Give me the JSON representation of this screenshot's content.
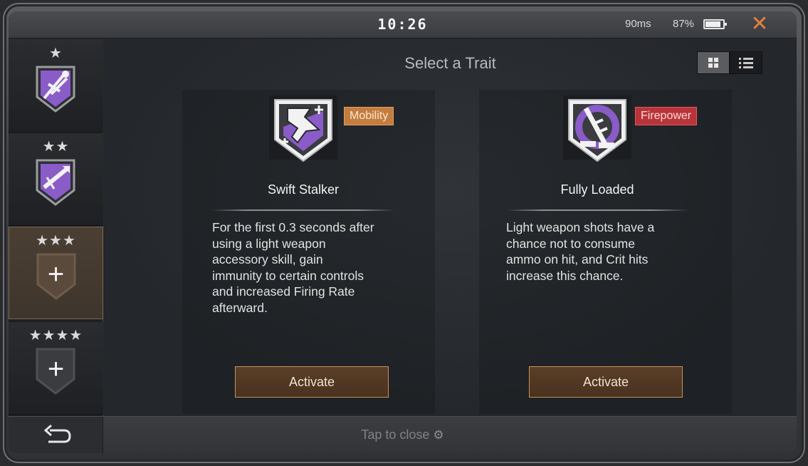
{
  "status_bar": {
    "time": "10:26",
    "ping": "90ms",
    "battery": "87%",
    "battery_level": 0.87,
    "close_icon": "close-x-icon"
  },
  "header": {
    "title": "Select a Trait",
    "view_toggle": [
      {
        "icon": "grid-view-icon",
        "selected": true
      },
      {
        "icon": "list-view-icon",
        "selected": false
      }
    ]
  },
  "sidebar": {
    "tiers": [
      {
        "stars": "★",
        "state": "filled",
        "icon": "trait-emblem-icon"
      },
      {
        "stars": "★★",
        "state": "filled",
        "icon": "trait-emblem-icon"
      },
      {
        "stars": "★★★",
        "state": "empty",
        "plus": "+",
        "active": true
      },
      {
        "stars": "★★★★",
        "state": "empty",
        "plus": "+"
      }
    ]
  },
  "traits": [
    {
      "name": "Swift Stalker",
      "tag": "Mobility",
      "tag_color": "#c47d3f",
      "icon": "swift-stalker-emblem-icon",
      "description": "For the first 0.3 seconds after\n using a light weapon\naccessory skill, gain\nimmunity to certain controls\nand increased Firing Rate\nafterward.",
      "button": "Activate"
    },
    {
      "name": "Fully Loaded",
      "tag": "Firepower",
      "tag_color": "#b8343a",
      "icon": "fully-loaded-emblem-icon",
      "description": "Light weapon shots have a\nchance not to consume\nammo on hit, and Crit hits\nincrease this chance.",
      "button": "Activate"
    }
  ],
  "footer": {
    "tap_to_close": "Tap to close",
    "back_icon": "back-arrow-icon",
    "gear_icon": "gear-icon"
  },
  "colors": {
    "accent_close": "#e0803e",
    "button_border": "#c7925a",
    "emblem_purple": "#8a5cc8"
  }
}
